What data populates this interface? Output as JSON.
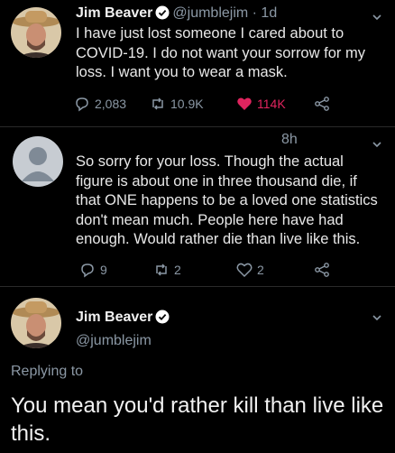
{
  "tweet1": {
    "author_name": "Jim Beaver",
    "author_handle": "@jumblejim",
    "time": "· 1d",
    "text": "I have just lost someone I cared about to COVID-19.  I do not want your sorrow for my loss.  I want you to wear a mask.",
    "replies": "2,083",
    "retweets": "10.9K",
    "likes": "114K",
    "liked": true
  },
  "tweet2": {
    "time": "8h",
    "text": "So sorry for your loss. Though the actual figure is about one in three thousand die, if that ONE happens to be a loved one statistics don't mean much. People here have had enough. Would rather die than live like this.",
    "replies": "9",
    "retweets": "2",
    "likes": "2"
  },
  "tweet3": {
    "author_name": "Jim Beaver",
    "author_handle": "@jumblejim",
    "replying_label": "Replying to",
    "text": "You mean you'd rather kill than live like this."
  },
  "colors": {
    "background": "#000000",
    "muted": "#8b98a5",
    "verified": "#ffffff",
    "like": "#e0245e"
  },
  "icons": [
    "verified-badge-icon",
    "chevron-down-icon",
    "reply-icon",
    "retweet-icon",
    "heart-icon",
    "share-icon"
  ]
}
